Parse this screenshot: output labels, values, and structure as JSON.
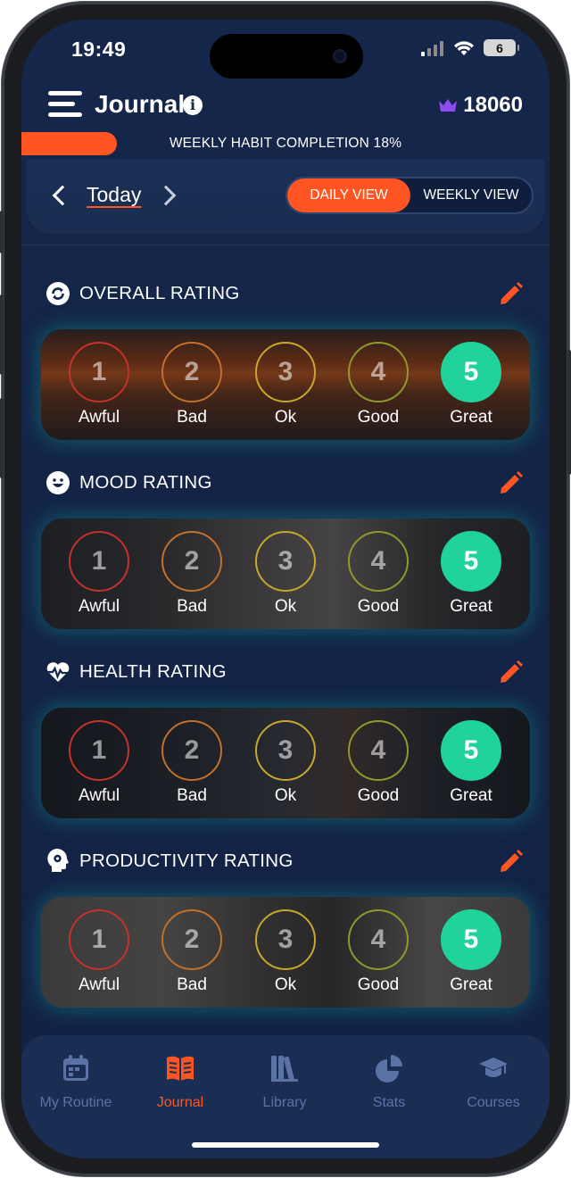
{
  "status_bar": {
    "time": "19:49",
    "battery": "6"
  },
  "header": {
    "title": "Journal",
    "points": "18060"
  },
  "progress": {
    "label": "WEEKLY HABIT COMPLETION 18%",
    "percent": 18
  },
  "date_nav": {
    "label": "Today"
  },
  "view_toggle": {
    "daily": "DAILY VIEW",
    "weekly": "WEEKLY VIEW",
    "selected": "daily"
  },
  "sections": [
    {
      "title": "OVERALL RATING",
      "icon": "refresh-icon",
      "selected": 5
    },
    {
      "title": "MOOD RATING",
      "icon": "smiley-icon",
      "selected": 5
    },
    {
      "title": "HEALTH RATING",
      "icon": "heartbeat-icon",
      "selected": 5
    },
    {
      "title": "PRODUCTIVITY RATING",
      "icon": "brain-gear-icon",
      "selected": 5
    }
  ],
  "rating_options": [
    {
      "value": "1",
      "label": "Awful"
    },
    {
      "value": "2",
      "label": "Bad"
    },
    {
      "value": "3",
      "label": "Ok"
    },
    {
      "value": "4",
      "label": "Good"
    },
    {
      "value": "5",
      "label": "Great"
    }
  ],
  "tabs": [
    {
      "label": "My Routine",
      "icon": "calendar-icon"
    },
    {
      "label": "Journal",
      "icon": "open-book-icon",
      "active": true
    },
    {
      "label": "Library",
      "icon": "books-icon"
    },
    {
      "label": "Stats",
      "icon": "pie-chart-icon"
    },
    {
      "label": "Courses",
      "icon": "graduation-cap-icon"
    }
  ],
  "colors": {
    "accent": "#ff5522",
    "selected_rating": "#1fd39a",
    "background": "#14264a",
    "tab_inactive": "#5b72a6"
  }
}
